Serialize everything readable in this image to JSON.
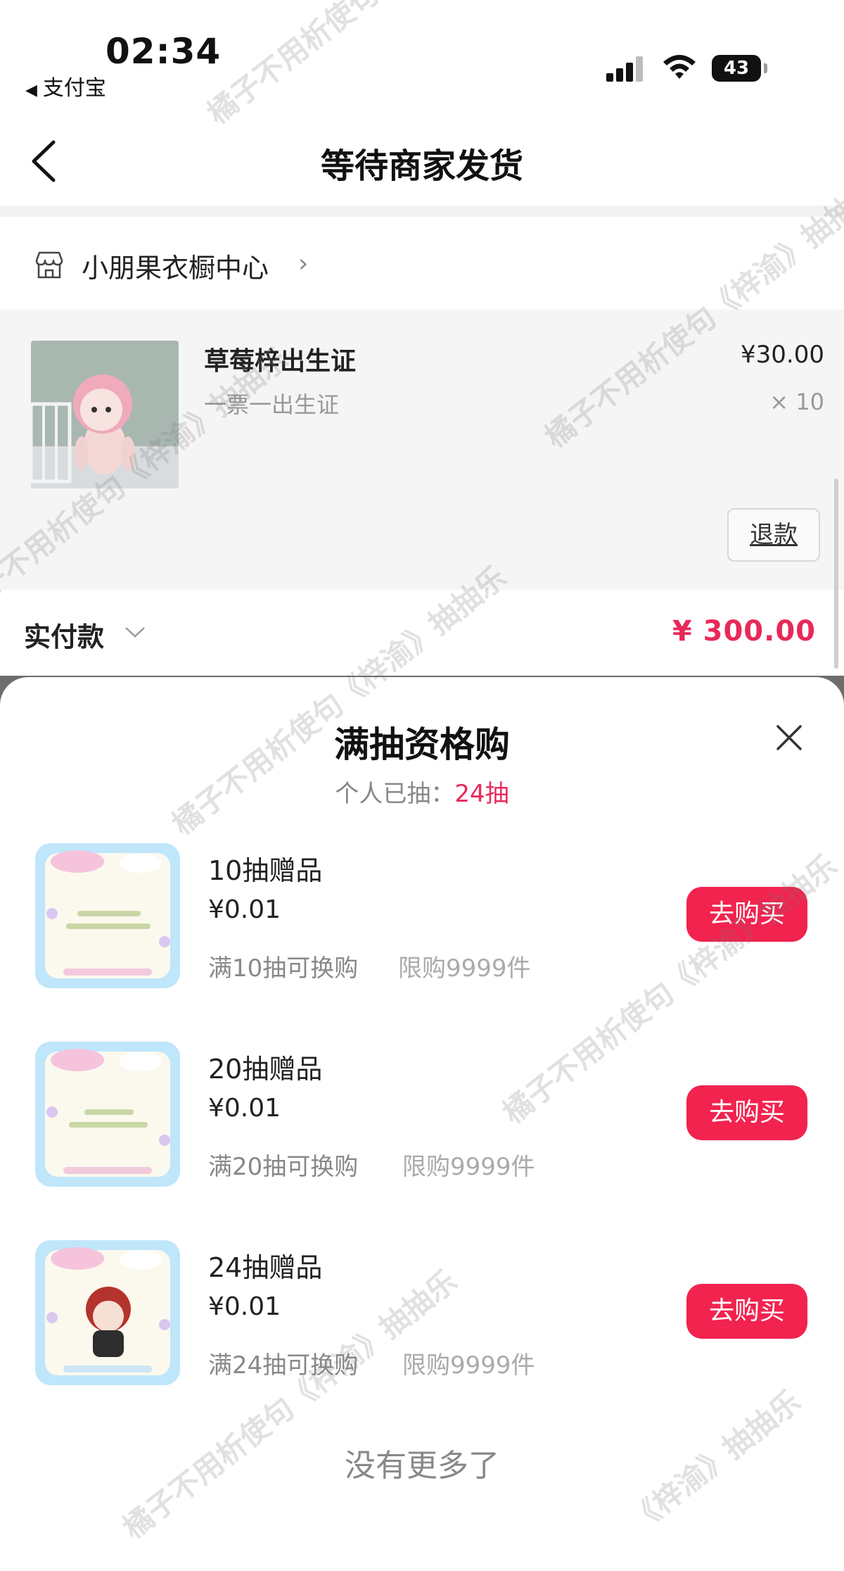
{
  "status_bar": {
    "time": "02:34",
    "back_app": "支付宝",
    "battery": "43"
  },
  "nav": {
    "title": "等待商家发货"
  },
  "shop": {
    "name": "小朋果衣橱中心"
  },
  "product": {
    "title": "草莓梓出生证",
    "subtitle": "一票一出生证",
    "price": "¥30.00",
    "quantity": "× 10",
    "refund_label": "退款"
  },
  "payment": {
    "label": "实付款",
    "amount": "¥ 300.00"
  },
  "sheet": {
    "title": "满抽资格购",
    "drawn_label": "个人已抽：",
    "drawn_count": "24抽",
    "items": [
      {
        "title": "10抽赠品",
        "price": "¥0.01",
        "condition": "满10抽可换购",
        "limit": "限购9999件",
        "button": "去购买"
      },
      {
        "title": "20抽赠品",
        "price": "¥0.01",
        "condition": "满20抽可换购",
        "limit": "限购9999件",
        "button": "去购买"
      },
      {
        "title": "24抽赠品",
        "price": "¥0.01",
        "condition": "满24抽可换购",
        "limit": "限购9999件",
        "button": "去购买"
      }
    ],
    "no_more": "没有更多了"
  },
  "watermark": {
    "text_a": "橘子不用析使句《梓渝》抽抽乐",
    "text_b": "《梓渝》抽抽乐"
  },
  "colors": {
    "accent": "#f2234f",
    "price_red": "#e8295a",
    "muted": "#888888"
  }
}
